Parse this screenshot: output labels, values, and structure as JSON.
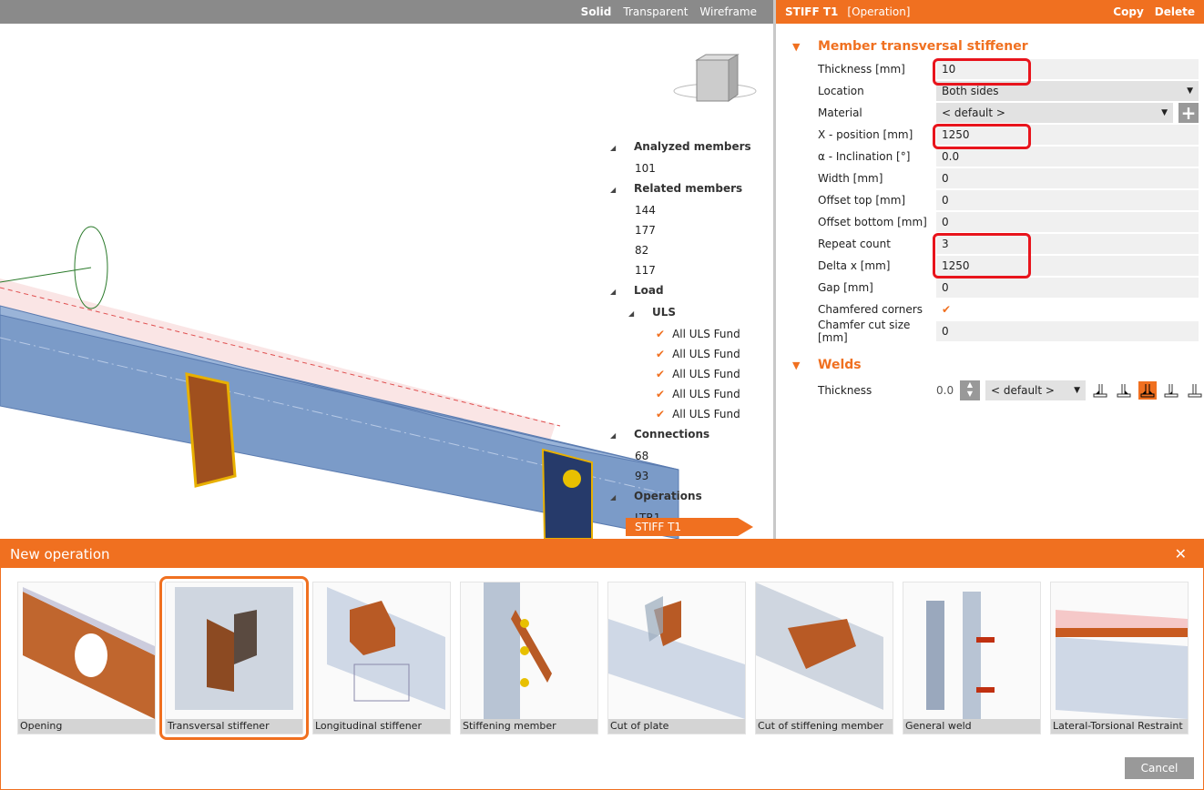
{
  "viewport": {
    "modes": [
      "Solid",
      "Transparent",
      "Wireframe"
    ],
    "active_mode": "Solid"
  },
  "tree": {
    "analyzed_label": "Analyzed members",
    "analyzed": [
      "101"
    ],
    "related_label": "Related members",
    "related": [
      "144",
      "177",
      "82",
      "117"
    ],
    "load_label": "Load",
    "uls_label": "ULS",
    "load_cases": [
      "All ULS Fund",
      "All ULS Fund",
      "All ULS Fund",
      "All ULS Fund",
      "All ULS Fund"
    ],
    "connections_label": "Connections",
    "connections": [
      "68",
      "93"
    ],
    "operations_label": "Operations",
    "operations": [
      "LTR1"
    ],
    "selected_operation": "STIFF T1"
  },
  "panel": {
    "title": "STIFF T1",
    "type": "[Operation]",
    "copy": "Copy",
    "delete": "Delete",
    "section1": "Member transversal stiffener",
    "fields": [
      {
        "label": "Thickness [mm]",
        "value": "10"
      },
      {
        "label": "Location",
        "value": "Both sides"
      },
      {
        "label": "Material",
        "value": "< default >"
      },
      {
        "label": "X - position [mm]",
        "value": "1250"
      },
      {
        "label": "α - Inclination [°]",
        "value": "0.0"
      },
      {
        "label": "Width [mm]",
        "value": "0"
      },
      {
        "label": "Offset top [mm]",
        "value": "0"
      },
      {
        "label": "Offset bottom [mm]",
        "value": "0"
      },
      {
        "label": "Repeat count",
        "value": "3"
      },
      {
        "label": "Delta x [mm]",
        "value": "1250"
      },
      {
        "label": "Gap [mm]",
        "value": "0"
      },
      {
        "label": "Chamfered corners",
        "value": "✔"
      },
      {
        "label": "Chamfer cut size [mm]",
        "value": "0"
      }
    ],
    "section2": "Welds",
    "weld": {
      "label": "Thickness",
      "value": "0.0",
      "material": "< default >"
    }
  },
  "dialog": {
    "title": "New operation",
    "cancel": "Cancel",
    "tiles": [
      "Opening",
      "Transversal stiffener",
      "Longitudinal stiffener",
      "Stiffening member",
      "Cut of plate",
      "Cut of stiffening member",
      "General weld",
      "Lateral-Torsional Restraint"
    ],
    "selected": "Transversal stiffener"
  },
  "colors": {
    "accent": "#f07020",
    "highlight": "#e8141c",
    "steel": "#7b9bc8"
  }
}
